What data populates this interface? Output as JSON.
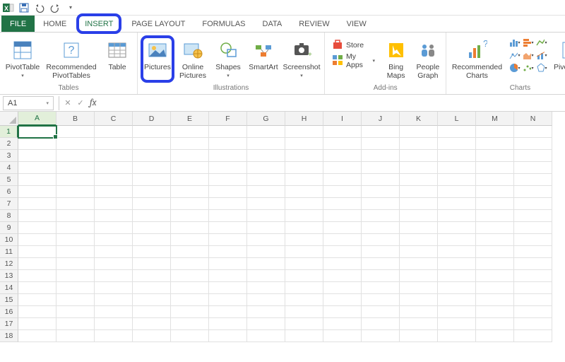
{
  "qat": {
    "save": "Save",
    "undo": "Undo",
    "redo": "Redo"
  },
  "tabs": [
    "FILE",
    "HOME",
    "INSERT",
    "PAGE LAYOUT",
    "FORMULAS",
    "DATA",
    "REVIEW",
    "VIEW"
  ],
  "active_tab": "INSERT",
  "ribbon": {
    "groups": [
      {
        "label": "Tables",
        "buttons": [
          {
            "label": "PivotTable",
            "drop": true
          },
          {
            "label": "Recommended\nPivotTables"
          },
          {
            "label": "Table"
          }
        ]
      },
      {
        "label": "Illustrations",
        "buttons": [
          {
            "label": "Pictures",
            "highlight": true
          },
          {
            "label": "Online\nPictures"
          },
          {
            "label": "Shapes",
            "drop": true
          },
          {
            "label": "SmartArt"
          },
          {
            "label": "Screenshot",
            "drop": true
          }
        ]
      },
      {
        "label": "Add-ins",
        "store": "Store",
        "myapps": "My Apps",
        "buttons": [
          {
            "label": "Bing\nMaps"
          },
          {
            "label": "People\nGraph"
          }
        ]
      },
      {
        "label": "Charts",
        "buttons_left": [
          {
            "label": "Recommended\nCharts"
          }
        ],
        "has_minis": true,
        "pivotchart": "PivotChart"
      }
    ]
  },
  "formula_bar": {
    "cell_ref": "A1",
    "fx": "fx",
    "value": ""
  },
  "columns": [
    "A",
    "B",
    "C",
    "D",
    "E",
    "F",
    "G",
    "H",
    "I",
    "J",
    "K",
    "L",
    "M",
    "N"
  ],
  "rows": [
    1,
    2,
    3,
    4,
    5,
    6,
    7,
    8,
    9,
    10,
    11,
    12,
    13,
    14,
    15,
    16,
    17,
    18
  ],
  "selected": {
    "col": "A",
    "row": 1
  }
}
